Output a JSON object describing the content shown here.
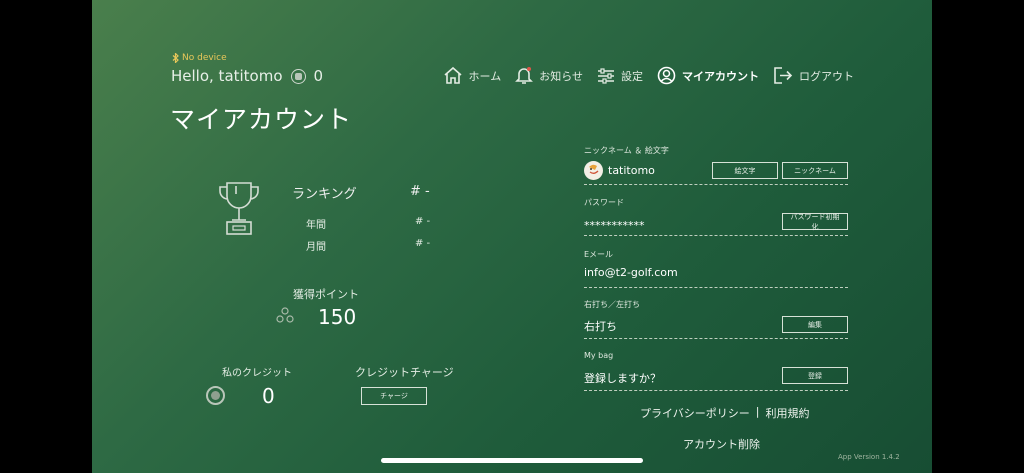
{
  "status": {
    "device": "No device"
  },
  "header": {
    "greeting": "Hello, tatitomo",
    "coin_count": "0"
  },
  "nav": {
    "home": "ホーム",
    "notifications": "お知らせ",
    "settings": "設定",
    "my_account": "マイアカウント",
    "logout": "ログアウト"
  },
  "page": {
    "title": "マイアカウント"
  },
  "ranking": {
    "label": "ランキング",
    "value": "# -",
    "yearly_label": "年間",
    "yearly_value": "# -",
    "monthly_label": "月間",
    "monthly_value": "# -"
  },
  "points": {
    "label": "獲得ポイント",
    "value": "150"
  },
  "credit": {
    "label": "私のクレジット",
    "value": "0",
    "charge_label": "クレジットチャージ",
    "charge_button": "チャージ"
  },
  "account": {
    "nickname_label": "ニックネーム ＆ 絵文字",
    "nickname": "tatitomo",
    "emoji_button": "絵文字",
    "nickname_button": "ニックネーム",
    "password_label": "パスワード",
    "password": "***********",
    "password_reset_button": "パスワード初期化",
    "email_label": "Eメール",
    "email": "info@t2-golf.com",
    "handedness_label": "右打ち／左打ち",
    "handedness": "右打ち",
    "edit_button": "編集",
    "bag_label": "My bag",
    "bag_value": "登録しますか？",
    "register_button": "登録"
  },
  "footer": {
    "privacy": "プライバシーポリシー",
    "separator": "|",
    "terms": "利用規約",
    "delete_account": "アカウント削除",
    "version": "App Version 1.4.2"
  }
}
